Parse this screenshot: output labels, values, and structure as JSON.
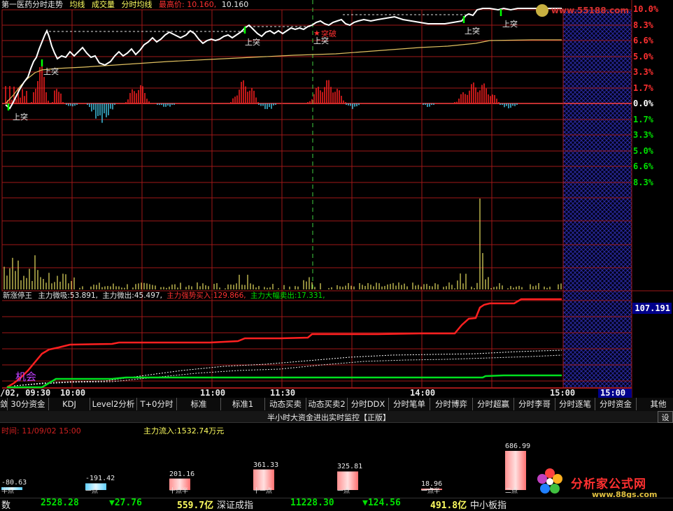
{
  "header": {
    "title": "第一医药分时走势",
    "legend_items": [
      "均线",
      "成交量",
      "分时均线"
    ],
    "high_label": "最高价:",
    "high_value": "10.160,",
    "high_value2": "10.160",
    "watermark": "www.55188.com"
  },
  "price_axis": {
    "up_labels": [
      "10.0%",
      "8.3%",
      "6.6%",
      "5.0%",
      "3.3%",
      "1.7%",
      "0.0%"
    ],
    "down_labels": [
      "1.7%",
      "3.3%",
      "5.0%",
      "6.6%",
      "8.3%"
    ],
    "colors": {
      "up": "#ff3030",
      "zero": "#ffffff",
      "down": "#00e000"
    }
  },
  "signals": {
    "breakthrough": "上突",
    "breakout": "突破"
  },
  "indicator": {
    "name": "新涨停王",
    "fields": [
      {
        "label": "主力微吸:",
        "value": "53.891,",
        "color": "#e0e0e0"
      },
      {
        "label": "主力微出:",
        "value": "45.497,",
        "color": "#e0e0e0"
      },
      {
        "label": "主力强势买入:",
        "value": "129.866,",
        "color": "#ff3030"
      },
      {
        "label": "主力大幅卖出:",
        "value": "17.331,",
        "color": "#00e000"
      }
    ],
    "current_value": "107.191",
    "opportunity_label": "机会"
  },
  "time_axis": {
    "start": "/02, 09:30",
    "labels": [
      "10:00",
      "11:00",
      "11:30",
      "14:00",
      "15:00"
    ],
    "cursor_time": "15:00"
  },
  "tabs": [
    "敛",
    "30分资金",
    "KDJ",
    "Level2分析",
    "T+0分时",
    "标准",
    "标准1",
    "动态买卖",
    "动态买卖2",
    "分时DDX",
    "分时笔单",
    "分时博弈",
    "分时超赢",
    "分时李哥",
    "分时逐笔",
    "分时资金",
    "其他"
  ],
  "monitor": {
    "title": "半小时大资金进出实时监控【正版】",
    "settings_label": "设",
    "time_label": "时间: 11/09/02 15:00",
    "flow_label": "主力流入:1532.74万元",
    "bars": [
      {
        "value": -80.63,
        "label": "-80.63",
        "period": "半点"
      },
      {
        "value": -191.42,
        "label": "-191.42",
        "period": "一点"
      },
      {
        "value": 201.16,
        "label": "201.16",
        "period": "十点半"
      },
      {
        "value": 361.33,
        "label": "361.33",
        "period": "十一点"
      },
      {
        "value": 325.81,
        "label": "325.81",
        "period": "一点"
      },
      {
        "value": 18.96,
        "label": "18.96",
        "period": "一点半"
      },
      {
        "value": 686.99,
        "label": "686.99",
        "period": "二点"
      }
    ],
    "logo_text": "分析家公式网",
    "logo_url": "www.88gs.com"
  },
  "bottom_bar": {
    "left_label": "数",
    "sh_value": "2528.28",
    "sh_change": "▼27.76",
    "sh_amount": "559.7亿",
    "sz_name": "深证成指",
    "sz_value": "11228.30",
    "sz_change": "▼124.56",
    "sz_amount": "491.8亿",
    "smb_name": "中小板指"
  }
}
